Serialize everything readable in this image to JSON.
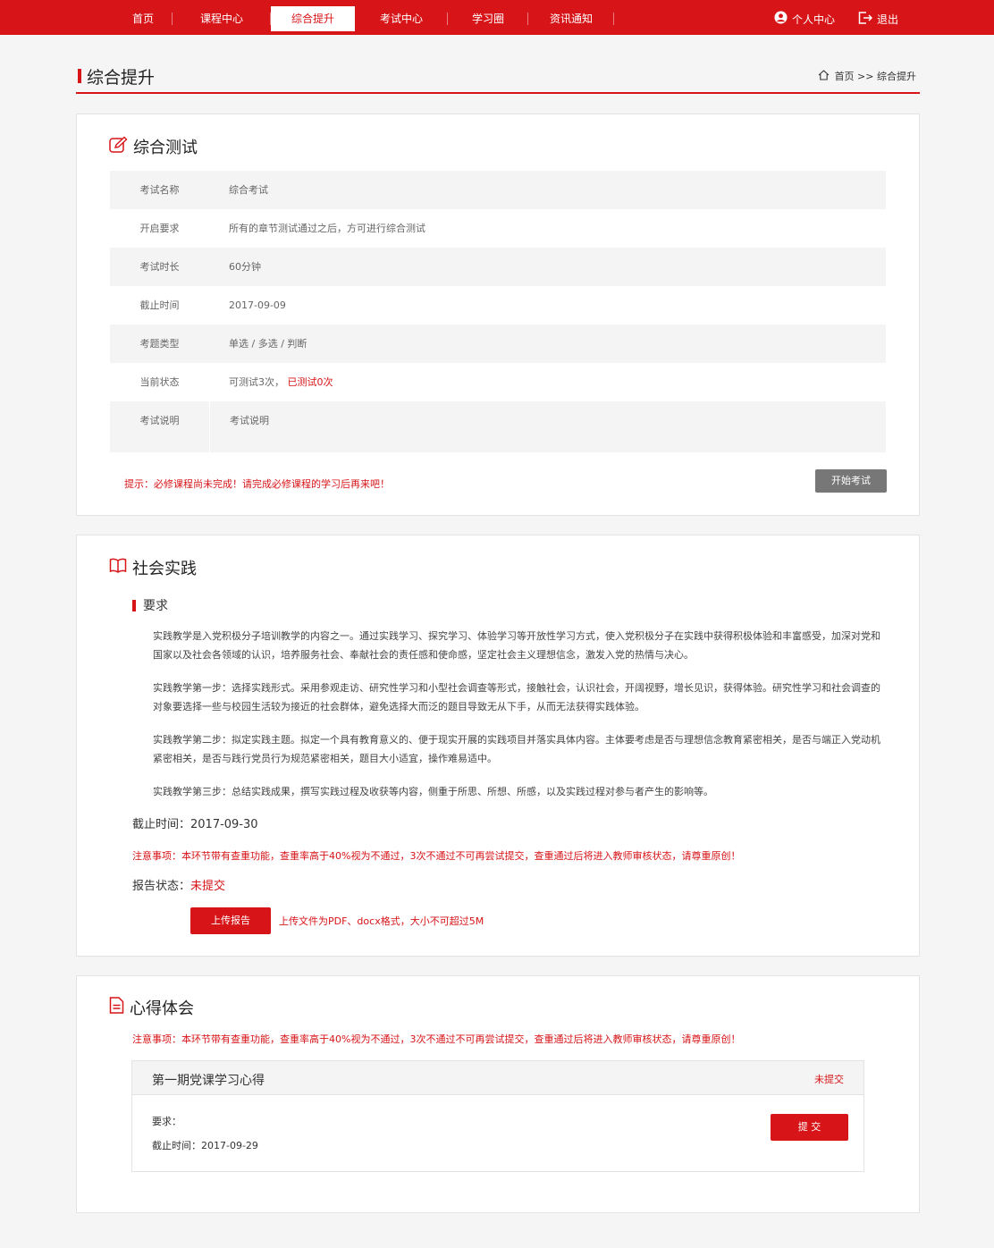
{
  "nav": {
    "items": [
      {
        "label": "首页"
      },
      {
        "label": "课程中心"
      },
      {
        "label": "综合提升"
      },
      {
        "label": "考试中心"
      },
      {
        "label": "学习圈"
      },
      {
        "label": "资讯通知"
      }
    ],
    "active_index": 2,
    "user_center": "个人中心",
    "logout": "退出"
  },
  "page": {
    "title": "综合提升",
    "breadcrumb": "首页 >> 综合提升"
  },
  "exam": {
    "title": "综合测试",
    "rows": [
      {
        "key": "考试名称",
        "value": "综合考试"
      },
      {
        "key": "开启要求",
        "value": "所有的章节测试通过之后，方可进行综合测试"
      },
      {
        "key": "考试时长",
        "value": "60分钟"
      },
      {
        "key": "截止时间",
        "value": "2017-09-09"
      },
      {
        "key": "考题类型",
        "value": "单选 / 多选 / 判断"
      },
      {
        "key": "当前状态",
        "value": "可测试3次，",
        "value_red": "已测试0次"
      },
      {
        "key": "考试说明",
        "value": "考试说明"
      }
    ],
    "tip": "提示：必修课程尚未完成！请完成必修课程的学习后再来吧！",
    "start_button": "开始考试"
  },
  "practice": {
    "title": "社会实践",
    "req_label": "要求",
    "paragraphs": [
      "实践教学是入党积极分子培训教学的内容之一。通过实践学习、探究学习、体验学习等开放性学习方式，使入党积极分子在实践中获得积极体验和丰富感受，加深对党和国家以及社会各领域的认识，培养服务社会、奉献社会的责任感和使命感，坚定社会主义理想信念，激发入党的热情与决心。",
      "实践教学第一步：选择实践形式。采用参观走访、研究性学习和小型社会调查等形式，接触社会，认识社会，开阔视野，增长见识，获得体验。研究性学习和社会调查的对象要选择一些与校园生活较为接近的社会群体，避免选择大而泛的题目导致无从下手，从而无法获得实践体验。",
      "实践教学第二步：拟定实践主题。拟定一个具有教育意义的、便于现实开展的实践项目并落实具体内容。主体要考虑是否与理想信念教育紧密相关，是否与端正入党动机紧密相关，是否与践行党员行为规范紧密相关，题目大小适宜，操作难易适中。",
      "实践教学第三步：总结实践成果，撰写实践过程及收获等内容，侧重于所思、所想、所感，以及实践过程对参与者产生的影响等。"
    ],
    "deadline": "截止时间：2017-09-30",
    "notice": "注意事项：本环节带有查重功能，查重率高于40%视为不通过，3次不通过不可再尝试提交，查重通过后将进入教师审核状态，请尊重原创！",
    "status_label": "报告状态：",
    "status_value": "未提交",
    "upload_button": "上传报告",
    "upload_hint": "上传文件为PDF、docx格式，大小不可超过5M"
  },
  "insight": {
    "title": "心得体会",
    "notice": "注意事项：本环节带有查重功能，查重率高于40%视为不通过，3次不通过不可再尝试提交，查重通过后将进入教师审核状态，请尊重原创！",
    "item_title": "第一期党课学习心得",
    "item_status": "未提交",
    "requirement": "要求：",
    "deadline": "截止时间：2017-09-29",
    "submit_button": "提 交"
  },
  "colors": {
    "brand": "#d71418",
    "button_gray": "#777777",
    "row_shade": "#f4f4f4"
  }
}
